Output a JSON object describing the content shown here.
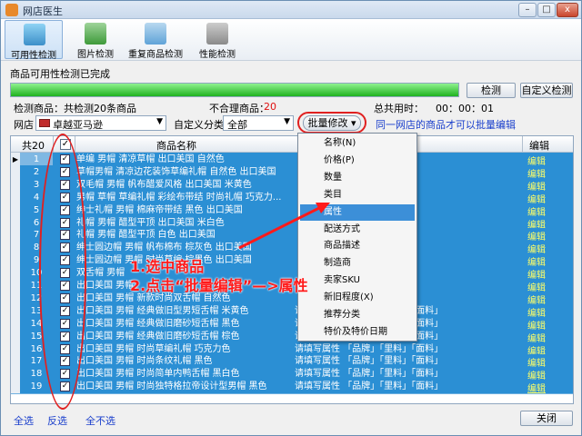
{
  "window": {
    "title": "网店医生",
    "min": "–",
    "max": "□",
    "close": "x"
  },
  "toolbar": [
    {
      "label": "可用性检测"
    },
    {
      "label": "图片检测"
    },
    {
      "label": "重复商品检测"
    },
    {
      "label": "性能检测"
    }
  ],
  "status": {
    "text": "商品可用性检测已完成",
    "progress": 1.0,
    "progress_color": "#1fb21f"
  },
  "buttons": {
    "check": "检测",
    "custom_check": "自定义检测",
    "close": "关闭"
  },
  "stats": {
    "checked_label": "检测商品：共检测20条商品",
    "bad_label": "不合理商品：",
    "bad_value": "20",
    "time_label": "总共用时：",
    "time_value": "00：00：01"
  },
  "filters": {
    "shop_label": "网店",
    "shop_value": "卓越亚马逊",
    "cat_label": "自定义分类",
    "cat_value": "全部",
    "batch_button": "批量修改",
    "hint": "同一网店的商品才可以批量编辑"
  },
  "grid": {
    "headers": {
      "count": "共20",
      "name": "商品名称",
      "edit": "编辑"
    },
    "rows": [
      {
        "n": "1",
        "name": "单编 男帽 清凉草帽 出口美国 自然色",
        "prop": "",
        "edit": "编辑"
      },
      {
        "n": "2",
        "name": "草帽男帽 清凉边花装饰草编礼帽 自然色 出口美国",
        "prop": "",
        "edit": "编辑"
      },
      {
        "n": "3",
        "name": "双毛帽 男帽 帆布醋爱风格 出口美国  米黄色",
        "prop": "",
        "edit": "编辑"
      },
      {
        "n": "4",
        "name": "男帽 草帽 草编礼帽 彩绘布带结 时尚礼帽 巧克力...",
        "prop": "",
        "edit": "编辑"
      },
      {
        "n": "5",
        "name": "绅士礼帽 男帽  棉麻帝带结 黑色 出口美国",
        "prop": "",
        "edit": "编辑"
      },
      {
        "n": "6",
        "name": "礼帽 男帽 醋型平顶 出口美国 米白色",
        "prop": "",
        "edit": "编辑"
      },
      {
        "n": "7",
        "name": "礼帽 男帽 醋型平顶 白色 出口美国",
        "prop": "",
        "edit": "编辑"
      },
      {
        "n": "8",
        "name": "绅士圆边帽 男帽 帆布棉布 棕灰色 出口美国",
        "prop": "",
        "edit": "编辑"
      },
      {
        "n": "9",
        "name": "绅士圆边帽 男帽 时尚草编 棕黑色 出口美国",
        "prop": "",
        "edit": "编辑"
      },
      {
        "n": "10",
        "name": "双舌帽 男帽 ",
        "prop": "",
        "edit": "编辑"
      },
      {
        "n": "11",
        "name": "出口美国 男帽 ",
        "prop": "",
        "edit": "编辑"
      },
      {
        "n": "12",
        "name": "出口美国 男帽 新款时尚双舌帽 自然色",
        "prop": "",
        "edit": "编辑"
      },
      {
        "n": "13",
        "name": "出口美国 男帽 经典做旧型男短舌帽 米黄色",
        "prop": "请填写属性 「品牌」「里料」「面料」",
        "edit": "编辑"
      },
      {
        "n": "14",
        "name": "出口美国 男帽 经典做旧磨砂短舌帽 黑色",
        "prop": "请填写属性 「品牌」「里料」「面料」",
        "edit": "编辑"
      },
      {
        "n": "15",
        "name": "出口美国 男帽 经典做旧磨砂短舌帽 棕色",
        "prop": "请填写属性 「品牌」「里料」「面料」",
        "edit": "编辑"
      },
      {
        "n": "16",
        "name": "出口美国 男帽 时尚草编礼帽 巧克力色",
        "prop": "请填写属性 「品牌」「里料」「面料」",
        "edit": "编辑"
      },
      {
        "n": "17",
        "name": "出口美国 男帽 时尚条纹礼帽 黑色",
        "prop": "请填写属性 「品牌」「里料」「面料」",
        "edit": "编辑"
      },
      {
        "n": "18",
        "name": "出口美国 男帽 时尚简单内鸭舌帽 黑白色",
        "prop": "请填写属性 「品牌」「里料」「面料」",
        "edit": "编辑"
      },
      {
        "n": "19",
        "name": "出口美国 男帽 时尚独特格拉帝设计型男帽 黑色",
        "prop": "请填写属性 「品牌」「里料」「面料」",
        "edit": "编辑"
      }
    ]
  },
  "menu": {
    "items": [
      "名称(N)",
      "价格(P)",
      "数量",
      "类目",
      "属性",
      "配送方式",
      "商品描述",
      "制造商",
      "卖家SKU",
      "新旧程度(X)",
      "推荐分类",
      "特价及特价日期"
    ],
    "highlighted": 4
  },
  "annotation": {
    "line1": "1.选中商品",
    "line2": "2.点击“批量编辑”—>属性",
    "color": "#ff1a1a"
  },
  "links": {
    "select_all": "全选",
    "invert": "反选",
    "none": "全不选"
  }
}
